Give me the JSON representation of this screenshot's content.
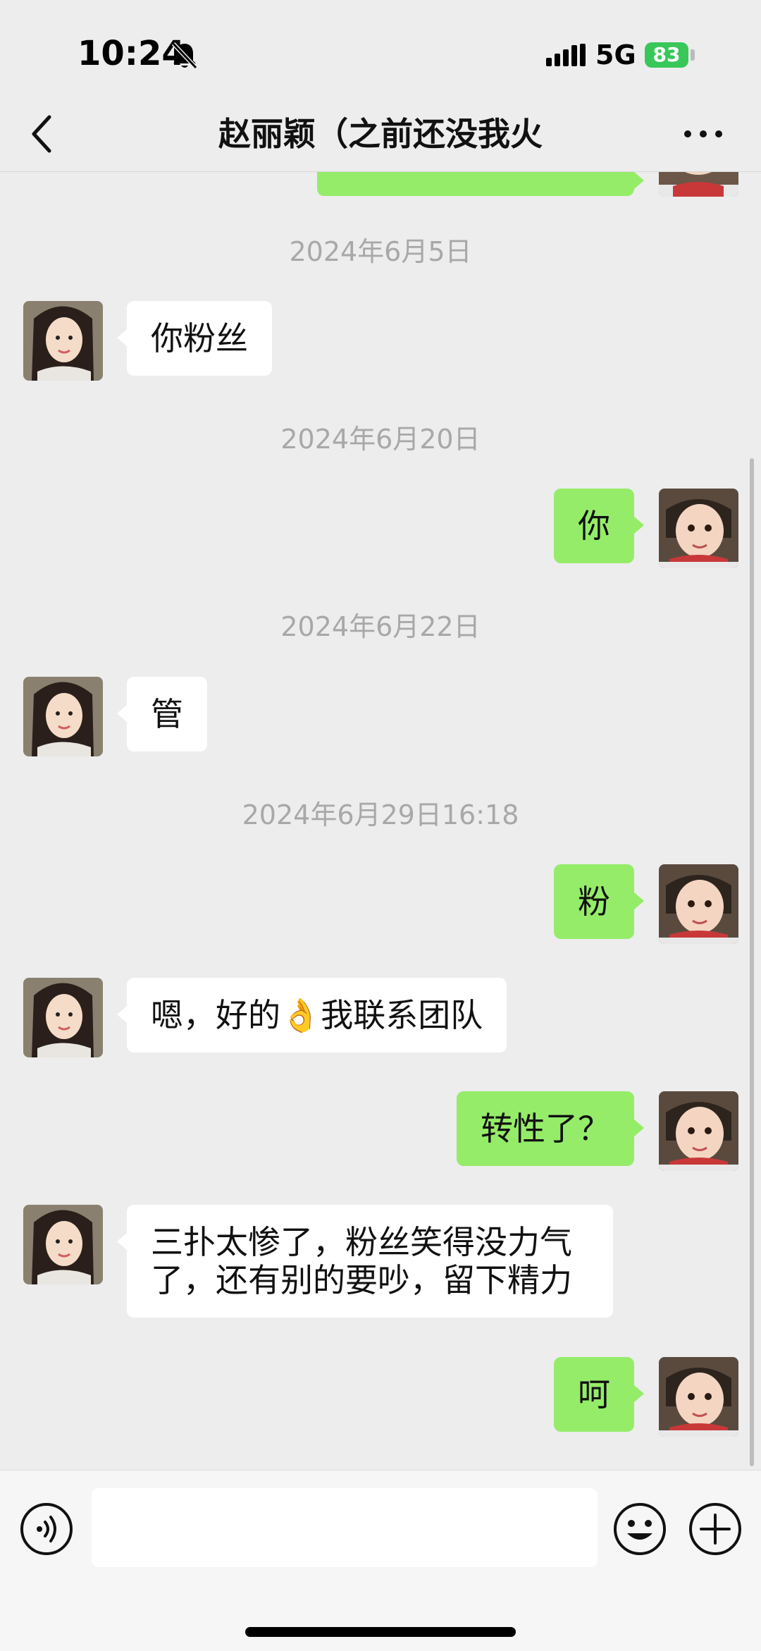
{
  "status_bar": {
    "time": "10:24",
    "network": "5G",
    "battery": "83"
  },
  "header": {
    "title": "赵丽颖（之前还没我火"
  },
  "chat": {
    "timestamps": [
      "2024年6月5日",
      "2024年6月20日",
      "2024年6月22日",
      "2024年6月29日16:18"
    ],
    "messages": [
      {
        "side": "in",
        "text": "你粉丝"
      },
      {
        "side": "out",
        "text": "你"
      },
      {
        "side": "in",
        "text": "管"
      },
      {
        "side": "out",
        "text": "粉"
      },
      {
        "side": "in",
        "text": "嗯，好的👌我联系团队"
      },
      {
        "side": "out",
        "text": "转性了？"
      },
      {
        "side": "in",
        "text": "三扑太惨了，粉丝笑得没力气了，还有别的要吵，留下精力"
      },
      {
        "side": "out",
        "text": "呵"
      }
    ]
  },
  "input": {
    "placeholder": ""
  },
  "colors": {
    "background": "#ededed",
    "bubble_out": "#95ec69",
    "bubble_in": "#ffffff",
    "battery": "#38c759"
  },
  "icons": [
    "back-icon",
    "more-icon",
    "voice-icon",
    "emoji-icon",
    "plus-icon",
    "bell-off-icon",
    "signal-icon"
  ]
}
